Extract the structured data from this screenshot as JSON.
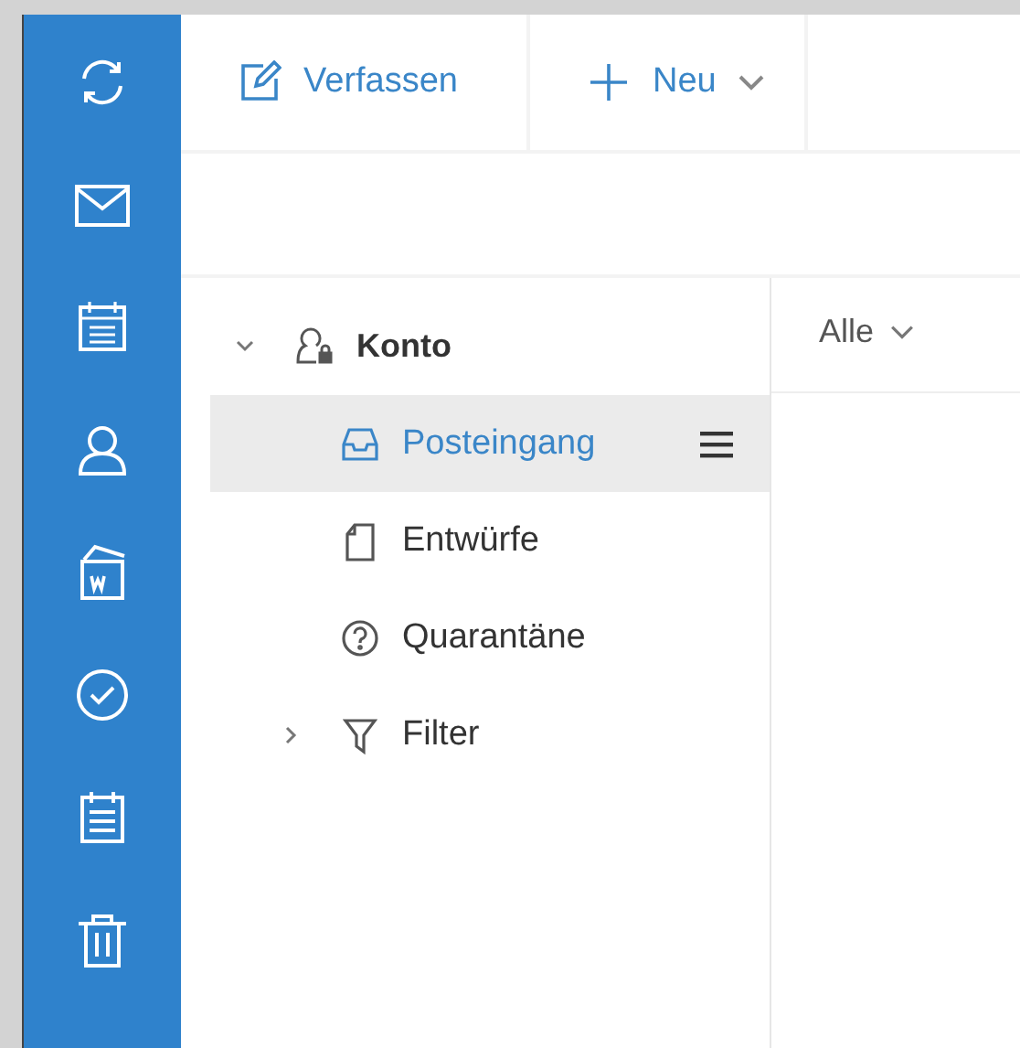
{
  "toolbar": {
    "buttons": [
      {
        "kind": "compose",
        "label": "Verfassen",
        "dropdown": false
      },
      {
        "kind": "new",
        "label": "Neu",
        "dropdown": true
      }
    ]
  },
  "tree": {
    "label": "Konto",
    "expanded": true,
    "selected": false,
    "children": [
      {
        "label": "Posteingang",
        "kind": "inbox",
        "selected": true
      },
      {
        "label": "Entwürfe",
        "kind": "drafts",
        "selected": false
      },
      {
        "label": "Quarantäne",
        "kind": "quarantine",
        "selected": false
      },
      {
        "label": "Filter",
        "kind": "filter",
        "selected": false,
        "expanded": false
      }
    ]
  },
  "list": {
    "filter": "Alle"
  }
}
